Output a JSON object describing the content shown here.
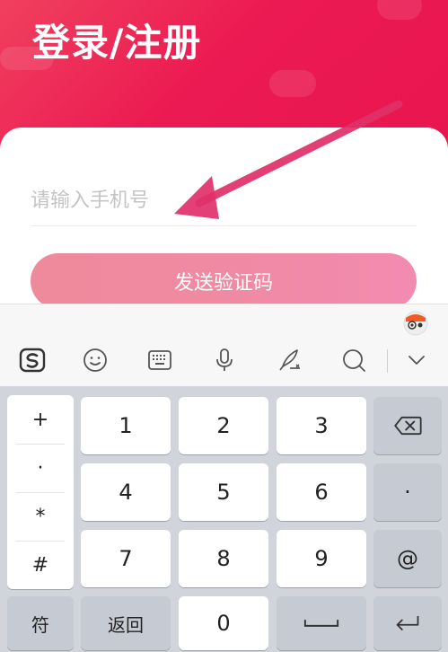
{
  "header": {
    "title": "登录/注册"
  },
  "form": {
    "phone_placeholder": "请输入手机号",
    "send_code_label": "发送验证码"
  },
  "colors": {
    "header_red": "#ec1a52",
    "button_pink": "#f08aa4",
    "arrow": "#e0306a"
  },
  "toolbar": {
    "icons": [
      "sogou-logo-icon",
      "emoji-icon",
      "keyboard-icon",
      "microphone-icon",
      "handwriting-icon",
      "search-icon",
      "collapse-chevron-icon"
    ]
  },
  "keyboard": {
    "symbols": [
      "+",
      "·",
      "*",
      "#"
    ],
    "keys": {
      "k1": "1",
      "k2": "2",
      "k3": "3",
      "k4": "4",
      "k5": "5",
      "k6": "6",
      "k7": "7",
      "k8": "8",
      "k9": "9",
      "k0": "0",
      "dot": "·",
      "at": "@",
      "fu": "符",
      "back": "返回"
    }
  }
}
